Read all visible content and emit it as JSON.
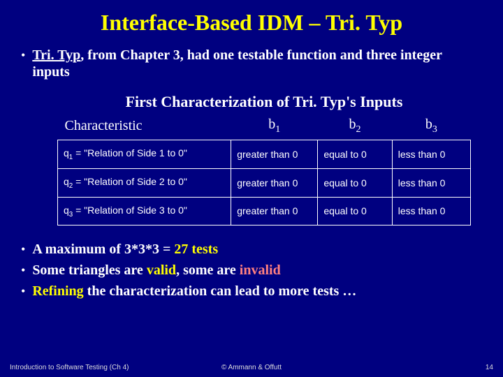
{
  "title": "Interface-Based IDM – Tri. Typ",
  "intro": {
    "link": "Tri. Typ",
    "rest": ", from Chapter 3, had one testable function and three integer inputs"
  },
  "table": {
    "caption": "First Characterization of Tri. Typ's Inputs",
    "headers": {
      "char": "Characteristic",
      "b1_base": "b",
      "b1_sub": "1",
      "b2_base": "b",
      "b2_sub": "2",
      "b3_base": "b",
      "b3_sub": "3"
    },
    "rows": [
      {
        "q_base": "q",
        "q_sub": "1",
        "q_rest": " = \"Relation of Side 1 to 0\"",
        "b1": "greater than 0",
        "b2": "equal to 0",
        "b3": "less than 0"
      },
      {
        "q_base": "q",
        "q_sub": "2",
        "q_rest": " = \"Relation of Side 2 to 0\"",
        "b1": "greater than 0",
        "b2": "equal to 0",
        "b3": "less than 0"
      },
      {
        "q_base": "q",
        "q_sub": "3",
        "q_rest": " = \"Relation of Side 3 to 0\"",
        "b1": "greater than 0",
        "b2": "equal to 0",
        "b3": "less than 0"
      }
    ]
  },
  "bullets": {
    "b1_pre": "A maximum of 3*3*3 = ",
    "b1_hl": "27 tests",
    "b2_pre": "Some triangles are ",
    "b2_valid": "valid",
    "b2_mid": ", some are ",
    "b2_invalid": "invalid",
    "b3_hl": "Refining",
    "b3_rest": " the characterization can lead to more tests …"
  },
  "footer": {
    "left": "Introduction to Software Testing (Ch 4)",
    "center": "© Ammann & Offutt",
    "right": "14"
  }
}
